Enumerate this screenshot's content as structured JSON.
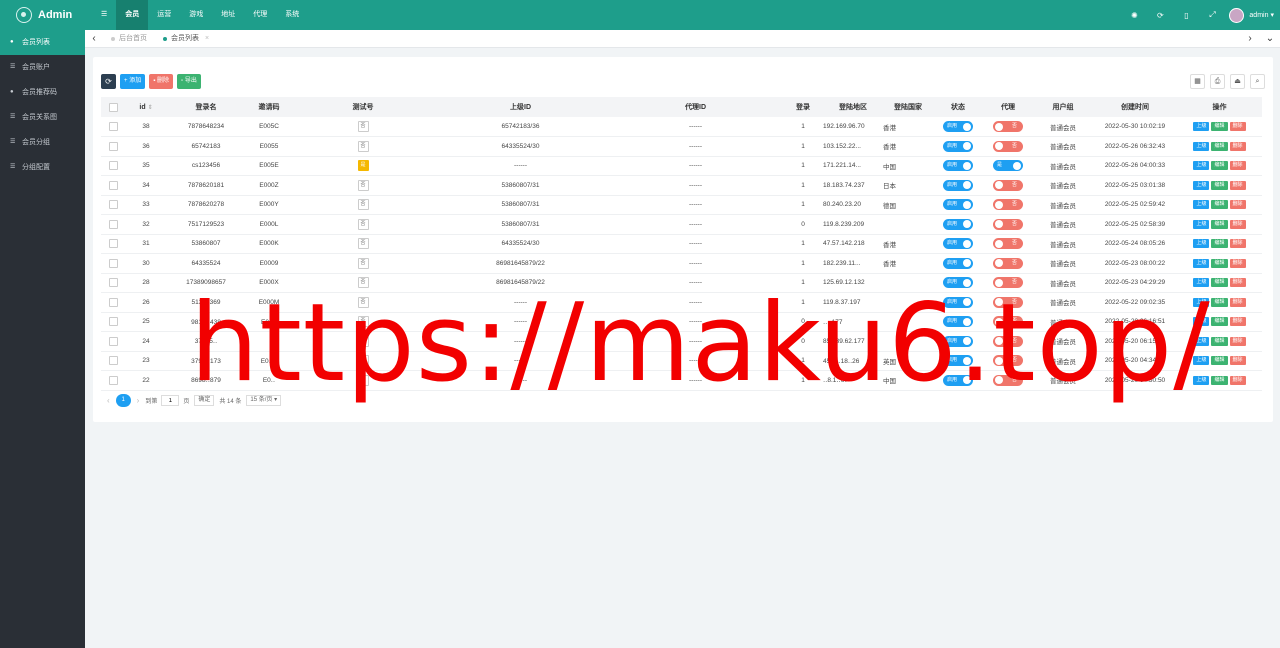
{
  "app": {
    "title": "Admin"
  },
  "topnav": {
    "menu_icon": "☰",
    "items": [
      {
        "label": "会员",
        "active": true
      },
      {
        "label": "运营",
        "active": false
      },
      {
        "label": "游戏",
        "active": false
      },
      {
        "label": "地址",
        "active": false
      },
      {
        "label": "代理",
        "active": false
      },
      {
        "label": "系统",
        "active": false
      }
    ],
    "user": "admin",
    "icons": [
      "theme-icon",
      "refresh-icon",
      "clear-icon",
      "fullscreen-icon"
    ]
  },
  "sidebar": {
    "items": [
      {
        "label": "会员列表",
        "active": true
      },
      {
        "label": "会员账户",
        "active": false
      },
      {
        "label": "会员推荐码",
        "active": false
      },
      {
        "label": "会员关系图",
        "active": false
      },
      {
        "label": "会员分组",
        "active": false
      },
      {
        "label": "分组配置",
        "active": false
      }
    ]
  },
  "tabs": [
    {
      "label": "后台首页",
      "active": false
    },
    {
      "label": "会员列表",
      "active": true,
      "close": "×"
    }
  ],
  "toolbar": {
    "add": "添加",
    "delete": "删除",
    "export": "导出"
  },
  "table": {
    "headers": {
      "id": "id",
      "login": "登录名",
      "invite": "邀请码",
      "test": "测试号",
      "parent": "上级ID",
      "agent_id": "代理ID",
      "logins": "登录",
      "region": "登陆地区",
      "country": "登陆国家",
      "status": "状态",
      "agent": "代理",
      "group": "用户组",
      "created": "创建时间",
      "ops": "操作"
    },
    "labels": {
      "on": "启用",
      "yes": "是",
      "no": "否",
      "up": "上级",
      "edit": "编辑",
      "del": "删除"
    },
    "rows": [
      {
        "id": "38",
        "login": "7878648234",
        "invite": "E005C",
        "test": false,
        "parent": "65742183/36",
        "agent_id": "------",
        "logins": "1",
        "region": "192.169.96.70",
        "country": "香港",
        "agent": false,
        "group": "普通会员",
        "created": "2022-05-30 10:02:19"
      },
      {
        "id": "36",
        "login": "65742183",
        "invite": "E0055",
        "test": false,
        "parent": "64335524/30",
        "agent_id": "------",
        "logins": "1",
        "region": "103.152.22...",
        "country": "香港",
        "agent": false,
        "group": "普通会员",
        "created": "2022-05-26 06:32:43"
      },
      {
        "id": "35",
        "login": "cs123456",
        "invite": "E005E",
        "test": true,
        "parent": "------",
        "agent_id": "------",
        "logins": "1",
        "region": "171.221.14...",
        "country": "中国",
        "agent": true,
        "group": "普通会员",
        "created": "2022-05-26 04:00:33"
      },
      {
        "id": "34",
        "login": "7878620181",
        "invite": "E000Z",
        "test": false,
        "parent": "53860807/31",
        "agent_id": "------",
        "logins": "1",
        "region": "18.183.74.237",
        "country": "日本",
        "agent": false,
        "group": "普通会员",
        "created": "2022-05-25 03:01:38"
      },
      {
        "id": "33",
        "login": "7878620278",
        "invite": "E000Y",
        "test": false,
        "parent": "53860807/31",
        "agent_id": "------",
        "logins": "1",
        "region": "80.240.23.20",
        "country": "德国",
        "agent": false,
        "group": "普通会员",
        "created": "2022-05-25 02:59:42"
      },
      {
        "id": "32",
        "login": "7517129523",
        "invite": "E000L",
        "test": false,
        "parent": "53860807/31",
        "agent_id": "------",
        "logins": "0",
        "region": "119.8.239.209",
        "country": "",
        "agent": false,
        "group": "普通会员",
        "created": "2022-05-25 02:58:39"
      },
      {
        "id": "31",
        "login": "53860807",
        "invite": "E000K",
        "test": false,
        "parent": "64335524/30",
        "agent_id": "------",
        "logins": "1",
        "region": "47.57.142.218",
        "country": "香港",
        "agent": false,
        "group": "普通会员",
        "created": "2022-05-24 08:05:26"
      },
      {
        "id": "30",
        "login": "64335524",
        "invite": "E0009",
        "test": false,
        "parent": "86981645879/22",
        "agent_id": "------",
        "logins": "1",
        "region": "182.239.11...",
        "country": "香港",
        "agent": false,
        "group": "普通会员",
        "created": "2022-05-23 08:00:22"
      },
      {
        "id": "28",
        "login": "17389098657",
        "invite": "E000X",
        "test": false,
        "parent": "86981645879/22",
        "agent_id": "------",
        "logins": "1",
        "region": "125.69.12.132",
        "country": "",
        "agent": false,
        "group": "普通会员",
        "created": "2022-05-23 04:29:29"
      },
      {
        "id": "26",
        "login": "51392369",
        "invite": "E000M",
        "test": false,
        "parent": "------",
        "agent_id": "------",
        "logins": "1",
        "region": "119.8.37.197",
        "country": "",
        "agent": false,
        "group": "普通会员",
        "created": "2022-05-22 09:02:35"
      },
      {
        "id": "25",
        "login": "9817‥438",
        "invite": "E0‥7",
        "test": false,
        "parent": "------",
        "agent_id": "------",
        "logins": "0",
        "region": "‥‥177",
        "country": "",
        "agent": false,
        "group": "普通会员",
        "created": "2022-05-20 06:16:51"
      },
      {
        "id": "24",
        "login": "37545‥",
        "invite": "",
        "test": false,
        "parent": "------",
        "agent_id": "------",
        "logins": "0",
        "region": "85.239.62.177",
        "country": "",
        "agent": false,
        "group": "普通会员",
        "created": "2022-05-20 06:15:08"
      },
      {
        "id": "23",
        "login": "3799‥173",
        "invite": "E0‥V",
        "test": false,
        "parent": "------",
        "agent_id": "------",
        "logins": "1",
        "region": "45.11.18‥26",
        "country": "英国",
        "agent": false,
        "group": "普通会员",
        "created": "2022-05-20 04:34:26"
      },
      {
        "id": "22",
        "login": "8698‥879",
        "invite": "E0‥",
        "test": false,
        "parent": "------",
        "agent_id": "------",
        "logins": "1",
        "region": "‥8.1‥67",
        "country": "中国",
        "agent": false,
        "group": "普通会员",
        "created": "2022-05-20 04:30:50"
      }
    ]
  },
  "pager": {
    "page": "1",
    "goto": "到第",
    "input": "1",
    "page_unit": "页",
    "confirm": "确定",
    "total": "共 14 条",
    "per_page": "15 条/页"
  },
  "watermark": "https://maku6.top/"
}
